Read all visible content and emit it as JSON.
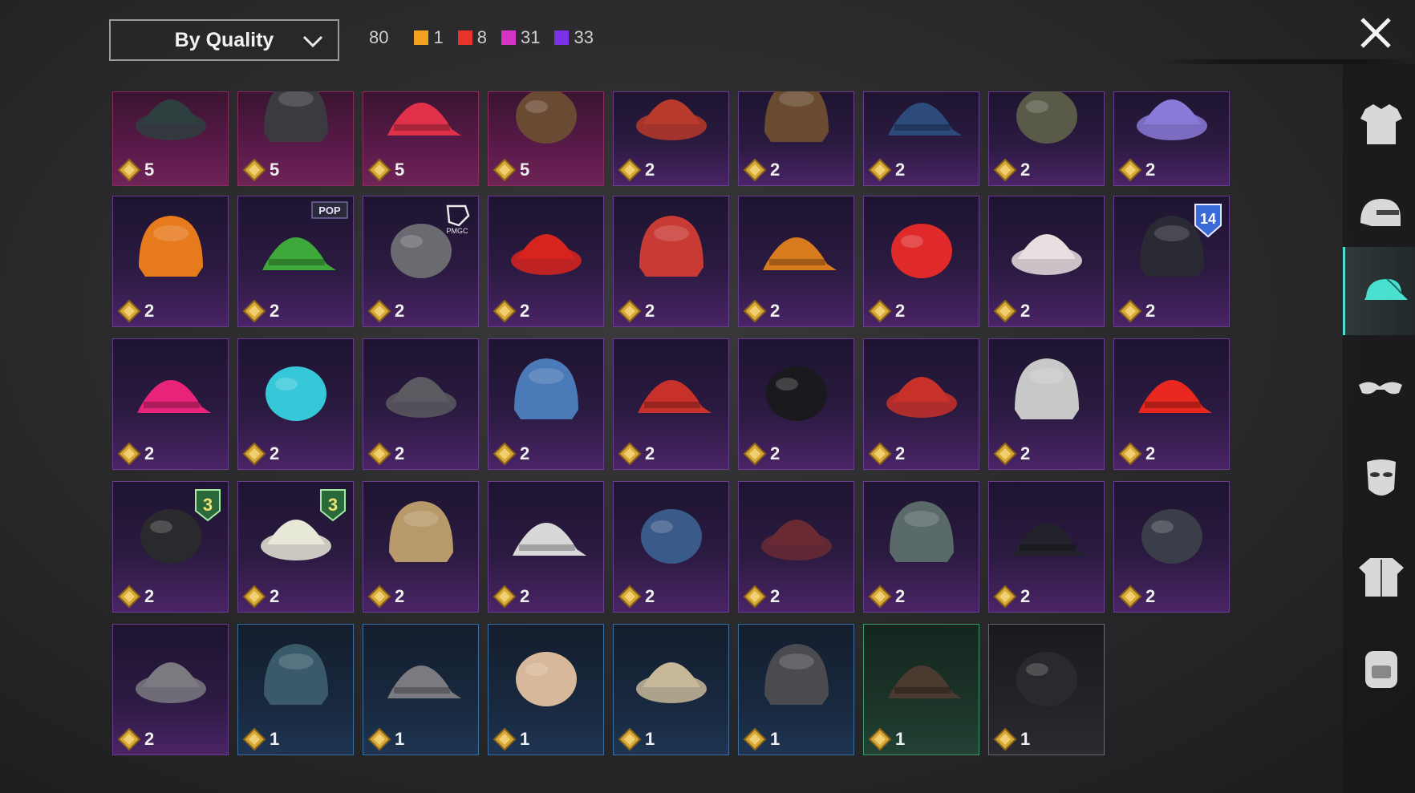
{
  "header": {
    "sort_label": "By Quality",
    "total_count": "80",
    "quality_counts": [
      {
        "color": "#f0a21e",
        "count": "1"
      },
      {
        "color": "#e8322c",
        "count": "8"
      },
      {
        "color": "#d634c8",
        "count": "31"
      },
      {
        "color": "#7a32e8",
        "count": "33"
      }
    ]
  },
  "items": [
    {
      "name": "bandana-beard-helmet",
      "qty": "5",
      "quality": "red",
      "icon": "#2f3e3e"
    },
    {
      "name": "officer-cap-mask",
      "qty": "5",
      "quality": "red",
      "icon": "#3a3a40"
    },
    {
      "name": "pink-hair-cap",
      "qty": "5",
      "quality": "red",
      "icon": "#e0304a"
    },
    {
      "name": "bear-head",
      "qty": "5",
      "quality": "red",
      "icon": "#6b4a34"
    },
    {
      "name": "red-hair-beanie",
      "qty": "2",
      "quality": "purple",
      "icon": "#b83a2a"
    },
    {
      "name": "long-brown-hair",
      "qty": "2",
      "quality": "purple",
      "icon": "#6a4a30"
    },
    {
      "name": "blue-white-cap",
      "qty": "2",
      "quality": "purple",
      "icon": "#2c4a7a"
    },
    {
      "name": "gold-visor-helmet",
      "qty": "2",
      "quality": "purple",
      "icon": "#5a5a48"
    },
    {
      "name": "holo-cap",
      "qty": "2",
      "quality": "purple",
      "icon": "#8a7ad8"
    },
    {
      "name": "orange-mech-helmet",
      "qty": "2",
      "quality": "purple",
      "icon": "#e87a1e"
    },
    {
      "name": "green-wig",
      "qty": "2",
      "quality": "purple",
      "icon": "#3ea83a",
      "badge": "POP"
    },
    {
      "name": "gray-cap-pmgc",
      "qty": "2",
      "quality": "purple",
      "icon": "#6a6a70",
      "badge": "PMGC"
    },
    {
      "name": "red-mohawk",
      "qty": "2",
      "quality": "purple",
      "icon": "#d8241e"
    },
    {
      "name": "football-helmet",
      "qty": "2",
      "quality": "purple",
      "icon": "#c83a34"
    },
    {
      "name": "tech-mask-hair",
      "qty": "2",
      "quality": "purple",
      "icon": "#d87a1e"
    },
    {
      "name": "skull-cap",
      "qty": "2",
      "quality": "purple",
      "icon": "#e02a2a"
    },
    {
      "name": "kabuki-mask",
      "qty": "2",
      "quality": "purple",
      "icon": "#e8e0e0"
    },
    {
      "name": "police-cap",
      "qty": "2",
      "quality": "purple",
      "icon": "#2a2a34",
      "badge": "14"
    },
    {
      "name": "pink-baseball-cap",
      "qty": "2",
      "quality": "purple",
      "icon": "#e8247a"
    },
    {
      "name": "teal-bob-wig",
      "qty": "2",
      "quality": "purple",
      "icon": "#36c8d8"
    },
    {
      "name": "silver-mask",
      "qty": "2",
      "quality": "purple",
      "icon": "#5a5a60"
    },
    {
      "name": "shark-hat",
      "qty": "2",
      "quality": "purple",
      "icon": "#4a7ab8"
    },
    {
      "name": "red-beret",
      "qty": "2",
      "quality": "purple",
      "icon": "#c8302a"
    },
    {
      "name": "black-top-hat",
      "qty": "2",
      "quality": "purple",
      "icon": "#1a1a1e"
    },
    {
      "name": "red-fedora",
      "qty": "2",
      "quality": "purple",
      "icon": "#c8302a"
    },
    {
      "name": "white-shark-head",
      "qty": "2",
      "quality": "purple",
      "icon": "#c8c8c8"
    },
    {
      "name": "red-bucket-hat",
      "qty": "2",
      "quality": "purple",
      "icon": "#e8281e"
    },
    {
      "name": "black-fedora",
      "qty": "2",
      "quality": "purple",
      "icon": "#2a2a2e",
      "badge": "3"
    },
    {
      "name": "flower-crown",
      "qty": "2",
      "quality": "purple",
      "icon": "#e8e8d8",
      "badge": "3"
    },
    {
      "name": "sundae-beanie",
      "qty": "2",
      "quality": "purple",
      "icon": "#b89a6a"
    },
    {
      "name": "head-mirror",
      "qty": "2",
      "quality": "purple",
      "icon": "#d8d8d8"
    },
    {
      "name": "blue-fez",
      "qty": "2",
      "quality": "purple",
      "icon": "#3a5a8a"
    },
    {
      "name": "maroon-fedora",
      "qty": "2",
      "quality": "purple",
      "icon": "#6a2a34"
    },
    {
      "name": "plaid-skull-wrap",
      "qty": "2",
      "quality": "purple",
      "icon": "#5a6a6a"
    },
    {
      "name": "black-bucket-hat",
      "qty": "2",
      "quality": "purple",
      "icon": "#22222a"
    },
    {
      "name": "aviator-cap",
      "qty": "2",
      "quality": "purple",
      "icon": "#3a3e48"
    },
    {
      "name": "camo-hat",
      "qty": "2",
      "quality": "purple",
      "icon": "#7a7a80"
    },
    {
      "name": "blue-beret",
      "qty": "1",
      "quality": "blue",
      "icon": "#3a5a6a"
    },
    {
      "name": "gray-beret",
      "qty": "1",
      "quality": "blue",
      "icon": "#7a7a80"
    },
    {
      "name": "trucker-cap-red",
      "qty": "1",
      "quality": "blue",
      "icon": "#d8b89a"
    },
    {
      "name": "trucker-cap-blue",
      "qty": "1",
      "quality": "blue",
      "icon": "#c8b89a"
    },
    {
      "name": "headset-cap",
      "qty": "1",
      "quality": "blue",
      "icon": "#4a4a50"
    },
    {
      "name": "brown-patrol-cap",
      "qty": "1",
      "quality": "green",
      "icon": "#4a3a30"
    },
    {
      "name": "black-beanie",
      "qty": "1",
      "quality": "gray",
      "icon": "#2a2a2e"
    }
  ],
  "nav": [
    {
      "name": "outfit-icon",
      "active": false
    },
    {
      "name": "helmet-icon",
      "active": false
    },
    {
      "name": "cap-icon",
      "active": true
    },
    {
      "name": "glasses-icon",
      "active": false
    },
    {
      "name": "mask-icon",
      "active": false
    },
    {
      "name": "jacket-icon",
      "active": false
    },
    {
      "name": "backpack-icon",
      "active": false
    }
  ]
}
